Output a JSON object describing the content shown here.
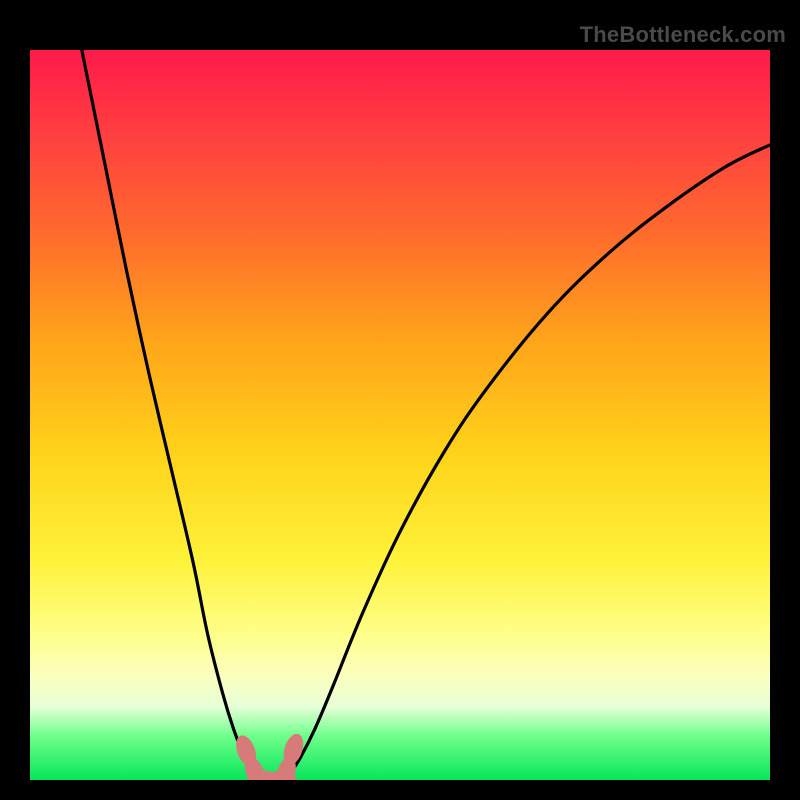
{
  "watermark": "TheBottleneck.com",
  "chart_data": {
    "type": "line",
    "title": "",
    "xlabel": "",
    "ylabel": "",
    "xlim": [
      0,
      100
    ],
    "ylim": [
      0,
      100
    ],
    "series": [
      {
        "name": "left-branch",
        "x": [
          7,
          10,
          13,
          16,
          19,
          22,
          24,
          26,
          27.5,
          29,
          30,
          30.8
        ],
        "y": [
          100,
          85,
          70,
          56,
          43,
          30,
          20,
          12,
          7,
          3,
          1,
          0
        ]
      },
      {
        "name": "right-branch",
        "x": [
          34.5,
          35.2,
          36.5,
          38.5,
          41,
          45,
          50,
          56,
          62,
          70,
          78,
          86,
          94,
          100
        ],
        "y": [
          0,
          1,
          3,
          7,
          13,
          23,
          34,
          45,
          54,
          64,
          72,
          78.5,
          84,
          87
        ]
      }
    ],
    "markers": [
      {
        "name": "left-marker-upper",
        "cx": 29.2,
        "cy": 4.0,
        "rx": 1.2,
        "ry": 2.2,
        "angle": -20
      },
      {
        "name": "left-marker-lower",
        "cx": 30.4,
        "cy": 1.0,
        "rx": 1.2,
        "ry": 2.2,
        "angle": -20
      },
      {
        "name": "right-marker-upper",
        "cx": 35.6,
        "cy": 4.2,
        "rx": 1.2,
        "ry": 2.2,
        "angle": 18
      },
      {
        "name": "right-marker-lower",
        "cx": 34.6,
        "cy": 1.0,
        "rx": 1.2,
        "ry": 2.2,
        "angle": 18
      },
      {
        "name": "bottom-pill-left",
        "cx": 31.5,
        "cy": 0.1,
        "rx": 2.0,
        "ry": 1.2,
        "angle": 0
      },
      {
        "name": "bottom-pill-right",
        "cx": 34.0,
        "cy": 0.1,
        "rx": 2.0,
        "ry": 1.2,
        "angle": 0
      }
    ],
    "colors": {
      "curve": "#000000",
      "marker_fill": "#d77a7a",
      "marker_stroke": "#b85a5a"
    }
  }
}
